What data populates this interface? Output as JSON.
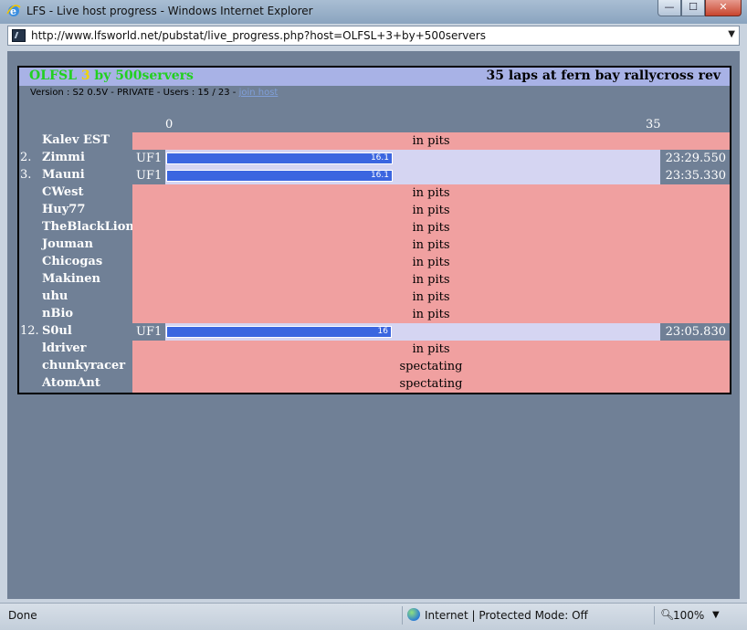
{
  "window": {
    "title": "LFS - Live host progress - Windows Internet Explorer",
    "min_label": "—",
    "max_label": "☐",
    "close_label": "✕"
  },
  "address": {
    "url": "http://www.lfsworld.net/pubstat/live_progress.php?host=OLFSL+3+by+500servers"
  },
  "header": {
    "server_name_a": "OLFSL ",
    "server_name_num": "3",
    "server_name_b": " by 500servers",
    "race_info": "35 laps at fern bay rallycross rev",
    "version_text": "Version : S2 0.5V - PRIVATE - Users : 15 / 23 - ",
    "join_link": "join host",
    "scale_start": "0",
    "scale_end": "35"
  },
  "rows": [
    {
      "pos": "",
      "name": "Kalev EST",
      "status": "in pits"
    },
    {
      "pos": "2.",
      "name": "Zimmi",
      "car": "UF1",
      "laps": 16.1,
      "bar_label": "16.1",
      "time": "23:29.550"
    },
    {
      "pos": "3.",
      "name": "Mauni",
      "car": "UF1",
      "laps": 16.1,
      "bar_label": "16.1",
      "time": "23:35.330"
    },
    {
      "pos": "",
      "name": "CWest",
      "status": "in pits"
    },
    {
      "pos": "",
      "name": "Huy77",
      "status": "in pits"
    },
    {
      "pos": "",
      "name": "TheBlackLion",
      "status": "in pits"
    },
    {
      "pos": "",
      "name": "Jouman",
      "status": "in pits"
    },
    {
      "pos": "",
      "name": "Chicogas",
      "status": "in pits"
    },
    {
      "pos": "",
      "name": "Makinen",
      "status": "in pits"
    },
    {
      "pos": "",
      "name": "uhu",
      "status": "in pits"
    },
    {
      "pos": "",
      "name": "nBio",
      "status": "in pits"
    },
    {
      "pos": "12.",
      "name": "S0ul",
      "car": "UF1",
      "laps": 16,
      "bar_label": "16",
      "time": "23:05.830"
    },
    {
      "pos": "",
      "name": "ldriver",
      "status": "in pits"
    },
    {
      "pos": "",
      "name": "chunkyracer",
      "status": "spectating"
    },
    {
      "pos": "",
      "name": "AtomAnt",
      "status": "spectating"
    }
  ],
  "total_laps": 35,
  "statusbar": {
    "status": "Done",
    "zone": "Internet | Protected Mode: Off",
    "zoom": "100%"
  },
  "colors": {
    "server_green": "#22d020",
    "server_yellow": "#f2d400",
    "pit_row": "#f0a0a0",
    "progress_track": "#d5d5f2",
    "progress_bar": "#3b66e0",
    "page_bg": "#708096"
  },
  "icons": {
    "browser": "ie-icon",
    "site": "lfsworld-favicon",
    "zone": "globe-icon",
    "zoom": "magnifier-icon"
  }
}
